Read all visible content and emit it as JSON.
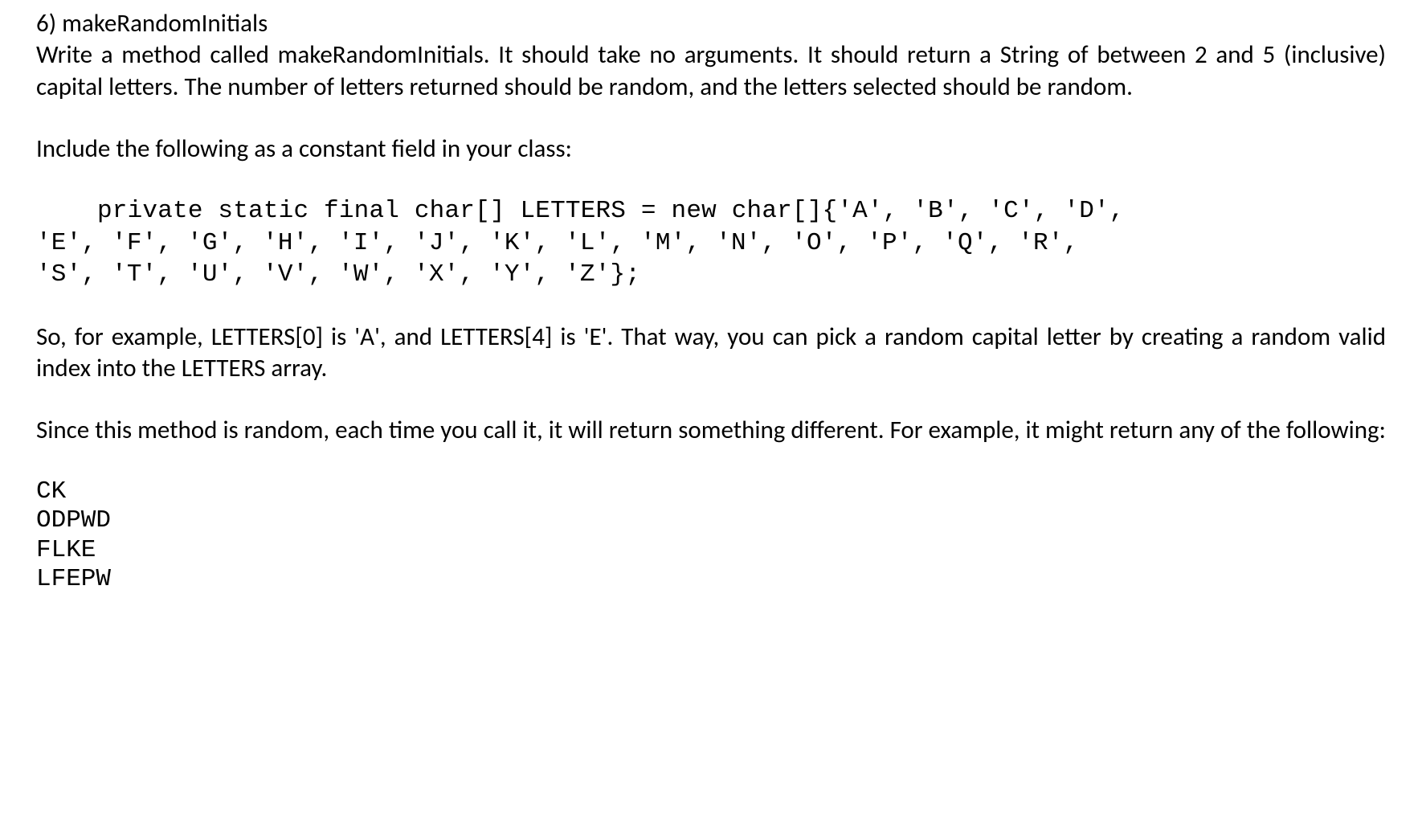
{
  "heading": "6) makeRandomInitials",
  "para1": "Write a method called makeRandomInitials. It should take no arguments. It should return a String of between 2 and 5 (inclusive) capital letters. The number of letters returned should be random, and the letters selected should be random.",
  "para2": "Include the following as a constant field in your class:",
  "code_line1": "private static final char[] LETTERS = new char[]{'A', 'B', 'C', 'D',",
  "code_line2": "'E', 'F', 'G', 'H', 'I', 'J', 'K', 'L', 'M', 'N', 'O', 'P', 'Q', 'R',",
  "code_line3": "'S', 'T', 'U', 'V', 'W', 'X', 'Y', 'Z'};",
  "para3": "So, for example, LETTERS[0] is 'A', and LETTERS[4] is 'E'. That way, you can pick a random capital letter by creating a random valid index into the LETTERS array.",
  "para4": "Since this method is random, each time you call it, it will return something different. For example, it might return any of the following:",
  "examples": [
    "CK",
    "ODPWD",
    "FLKE",
    "LFEPW"
  ]
}
